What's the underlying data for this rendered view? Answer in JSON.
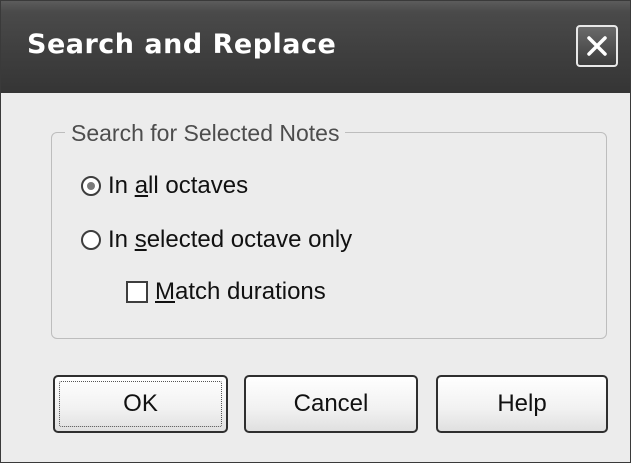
{
  "window": {
    "title": "Search and Replace",
    "close_icon": "close-icon"
  },
  "group": {
    "label": "Search for Selected Notes",
    "options": [
      {
        "prefix": "In ",
        "mnemonic": "a",
        "suffix": "ll octaves",
        "checked": true
      },
      {
        "prefix": "In ",
        "mnemonic": "s",
        "suffix": "elected octave only",
        "checked": false
      }
    ],
    "match_durations": {
      "mnemonic": "M",
      "suffix": "atch durations",
      "checked": false
    }
  },
  "buttons": {
    "ok": "OK",
    "cancel": "Cancel",
    "help": "Help"
  }
}
